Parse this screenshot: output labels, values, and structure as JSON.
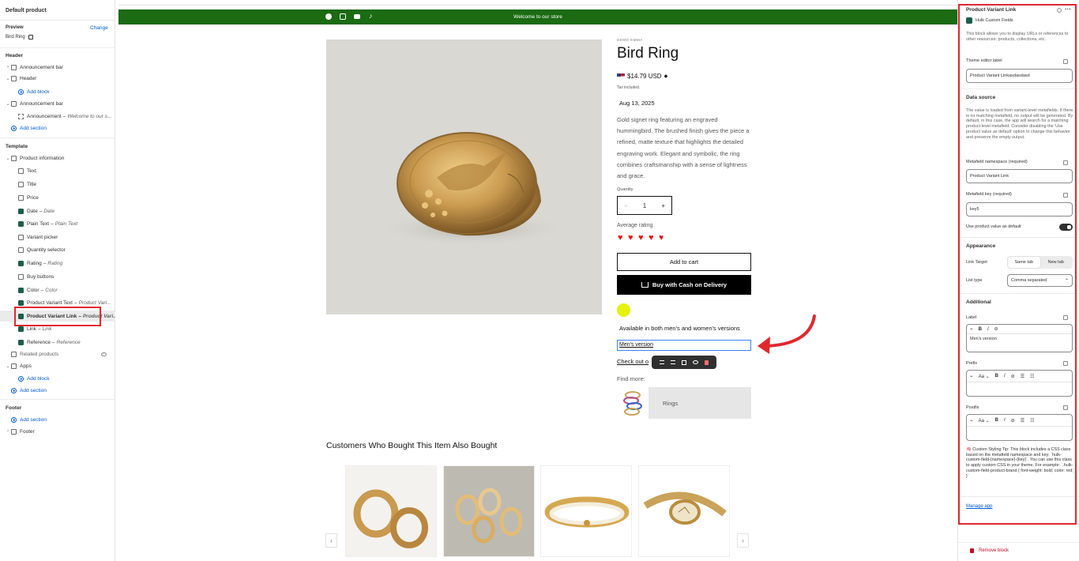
{
  "left": {
    "title": "Default product",
    "preview_label": "Preview",
    "change_link": "Change",
    "preview_value": "Bird Ring",
    "header_section": "Header",
    "header_items": [
      {
        "label": "Announcement bar",
        "icon": "section-icon"
      },
      {
        "label": "Header",
        "icon": "section-icon"
      }
    ],
    "add_block_1": "Add block",
    "announcement_bar": "Announcement bar",
    "announcement_item": "Announcement",
    "announcement_item_sub": "Welcome to our s...",
    "add_section_1": "Add section",
    "template_section": "Template",
    "product_information": "Product information",
    "blocks": [
      {
        "label": "Text",
        "sub": "",
        "icon": "text-icon"
      },
      {
        "label": "Title",
        "sub": "",
        "icon": "title-icon"
      },
      {
        "label": "Price",
        "sub": "",
        "icon": "price-tag-icon"
      },
      {
        "label": "Date",
        "sub": "Date",
        "icon": "app-block-icon"
      },
      {
        "label": "Plain Text",
        "sub": "Plain Text",
        "icon": "app-block-icon"
      },
      {
        "label": "Variant picker",
        "sub": "",
        "icon": "variant-icon"
      },
      {
        "label": "Quantity selector",
        "sub": "",
        "icon": "hash-icon"
      },
      {
        "label": "Rating",
        "sub": "Rating",
        "icon": "app-block-icon"
      },
      {
        "label": "Buy buttons",
        "sub": "",
        "icon": "cart-icon"
      },
      {
        "label": "Color",
        "sub": "Color",
        "icon": "app-block-icon"
      },
      {
        "label": "Product Variant Text",
        "sub": "Product Vari...",
        "icon": "app-block-icon"
      },
      {
        "label": "Product Variant Link",
        "sub": "Product Vari...",
        "icon": "app-block-icon"
      },
      {
        "label": "Link",
        "sub": "Link",
        "icon": "app-block-icon"
      },
      {
        "label": "Reference",
        "sub": "Reference",
        "icon": "app-block-icon"
      }
    ],
    "related_products": "Related products",
    "apps": "Apps",
    "add_block_2": "Add block",
    "add_section_2": "Add section",
    "footer_section": "Footer",
    "add_section_3": "Add section",
    "footer_item": "Footer"
  },
  "store": {
    "announcement": "Welcome to our store",
    "social_icons": [
      "facebook-icon",
      "instagram-icon",
      "youtube-icon",
      "tiktok-icon"
    ],
    "vendor": "DEMO EMMA",
    "title": "Bird Ring",
    "price": "$14.79 USD",
    "tax": "Tax included.",
    "date": "Aug 13, 2025",
    "description": "Gold signet ring featuring an engraved hummingbird. The brushed finish gives the piece a refined, matte texture that highlights the detailed engraving work. Elegant and symbolic, the ring combines craftsmanship with a sense of lightness and grace.",
    "quantity_label": "Quantity",
    "quantity_value": "1",
    "minus": "−",
    "plus": "+",
    "rating_label": "Average rating",
    "rating_value": 4.5,
    "add_to_cart": "Add to cart",
    "buy_cod": "Buy with Cash on Delivery",
    "swatch_color": "#e5f20a",
    "availability": "Available in both men's and women's versions",
    "mens_version": "Men's version",
    "check_out": "Check out o",
    "find_more": "Find more:",
    "rings": "Rings",
    "recommend_title": "Customers Who Bought This Item Also Bought",
    "prev": "‹",
    "next": "›",
    "accent": "#1a6b12"
  },
  "right": {
    "title": "Product Variant Link",
    "app_name": "Hulk Custom Fields",
    "description": "This block allows you to display URLs or references to other resources: products, collections, etc.",
    "theme_editor_label": "Theme editor label",
    "theme_editor_value": "Product Variant Linkasdasdasd",
    "data_source": "Data source",
    "data_source_text": "The value is loaded from variant-level metafields. If there is no matching metafield, no output will be generated. By default, in this case, the app will search for a matching product-level metafield. Consider disabling the 'Use product value as default' option to change this behavior and preserve the empty output.",
    "namespace_label": "Metafield namespace (required)",
    "namespace_value": "Product Variant Link",
    "key_label": "Metafield key (required)",
    "key_value": "key5",
    "use_default_label": "Use product value as default",
    "use_default_on": true,
    "appearance": "Appearance",
    "link_target_label": "Link Target",
    "same_tab": "Same tab",
    "new_tab": "New tab",
    "list_type_label": "List type",
    "list_type_value": "Comma separated",
    "additional": "Additional",
    "label_label": "Label",
    "label_value": "Men's version",
    "prefix_label": "Prefix",
    "postfix_label": "Postfix",
    "aa": "Aa",
    "tip": "🧠 Custom Styling Tip: This block includes a CSS class based on the metafield namespace and key: `hulk-custom-field-{namespace}-{key}`. You can use this class to apply custom CSS in your theme. For example: `.hulk-custom-field-product-brand { font-weight: bold; color: red; }`",
    "manage_app": "Manage app",
    "remove_block": "Remove block"
  },
  "colors": {
    "highlight": "#e0282e",
    "shopify_blue": "#005bd3"
  }
}
